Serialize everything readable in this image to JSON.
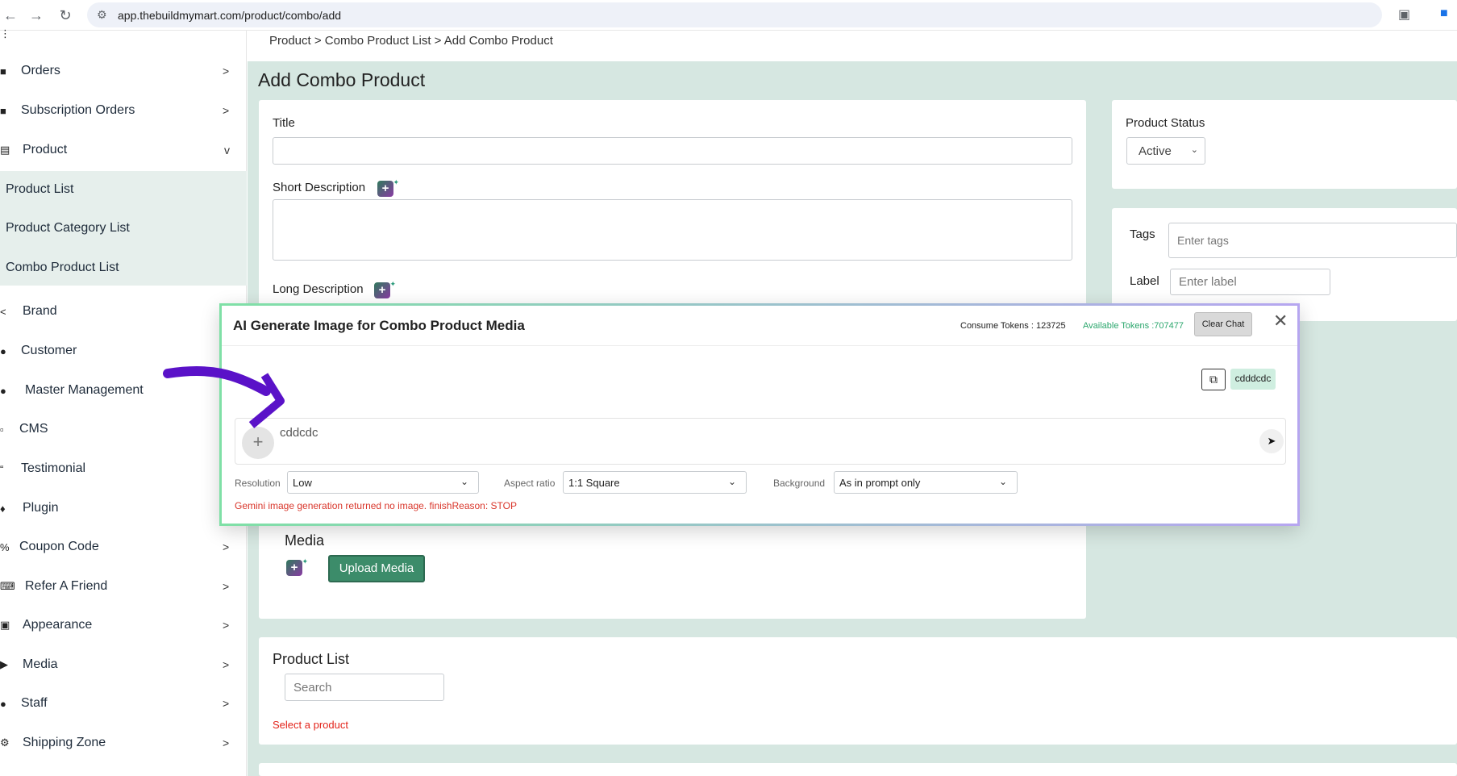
{
  "browser": {
    "url": "app.thebuildmymart.com/product/combo/add"
  },
  "sidebar": {
    "items": [
      {
        "label": "Orders",
        "icon": "bag-icon",
        "chevron": ">"
      },
      {
        "label": "Subscription Orders",
        "icon": "bag-icon",
        "chevron": ">"
      },
      {
        "label": "Product",
        "icon": "box-icon",
        "chevron": "v"
      },
      {
        "label": "Brand",
        "icon": "share-icon",
        "chevron": ""
      },
      {
        "label": "Customer",
        "icon": "user-icon",
        "chevron": ""
      },
      {
        "label": "Master Management",
        "icon": "users-gear-icon",
        "chevron": ""
      },
      {
        "label": "CMS",
        "icon": "doc-icon",
        "chevron": ""
      },
      {
        "label": "Testimonial",
        "icon": "quote-icon",
        "chevron": ""
      },
      {
        "label": "Plugin",
        "icon": "puzzle-icon",
        "chevron": ""
      },
      {
        "label": "Coupon Code",
        "icon": "percent-icon",
        "chevron": ">"
      },
      {
        "label": "Refer A Friend",
        "icon": "keyboard-icon",
        "chevron": ">"
      },
      {
        "label": "Appearance",
        "icon": "image-icon",
        "chevron": ">"
      },
      {
        "label": "Media",
        "icon": "play-icon",
        "chevron": ">"
      },
      {
        "label": "Staff",
        "icon": "user-icon",
        "chevron": ">"
      },
      {
        "label": "Shipping Zone",
        "icon": "gear-icon",
        "chevron": ">"
      }
    ],
    "sub_items": [
      "Product List",
      "Product Category List",
      "Combo Product List"
    ]
  },
  "breadcrumb": "Product > Combo Product List > Add Combo Product",
  "page_title": "Add Combo Product",
  "form": {
    "title_label": "Title",
    "short_desc_label": "Short Description",
    "long_desc_label": "Long Description",
    "media_label": "Media",
    "upload_media": "Upload Media"
  },
  "right_panel": {
    "status_label": "Product Status",
    "status_value": "Active",
    "tags_label": "Tags",
    "tags_placeholder": "Enter tags",
    "label_label": "Label",
    "label_placeholder": "Enter label"
  },
  "product_list": {
    "heading": "Product List",
    "search_placeholder": "Search",
    "error": "Select a product"
  },
  "modal": {
    "title": "AI Generate Image for Combo Product Media",
    "consume_tokens": "Consume Tokens : 123725",
    "available_tokens": "Available Tokens :707477",
    "clear_chat": "Clear Chat",
    "chat_message": "cdddcdc",
    "prompt_value": "cddcdc",
    "resolution_label": "Resolution",
    "resolution_value": "Low",
    "aspect_label": "Aspect ratio",
    "aspect_value": "1:1 Square",
    "background_label": "Background",
    "background_value": "As in prompt only",
    "error": "Gemini image generation returned no image. finishReason: STOP"
  },
  "colors": {
    "accent_green": "#3c8c6a",
    "page_bg": "#d6e7e1",
    "error_red": "#d9362b",
    "annotation_arrow": "#5a12c8"
  }
}
